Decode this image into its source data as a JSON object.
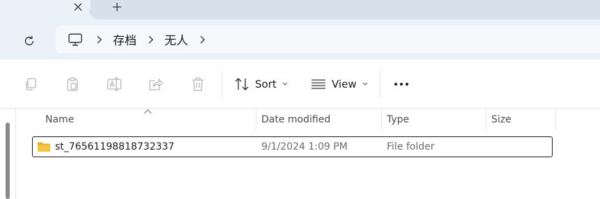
{
  "tabs": {
    "close_icon": "close-icon",
    "new_tab_icon": "plus-icon"
  },
  "address": {
    "refresh_icon": "refresh-icon",
    "pc_icon": "computer-icon",
    "breadcrumb": [
      "存档",
      "无人"
    ]
  },
  "toolbar": {
    "copy_icon": "copy-icon",
    "paste_icon": "paste-icon",
    "rename_icon": "rename-icon",
    "share_icon": "share-icon",
    "delete_icon": "delete-icon",
    "sort_label": "Sort",
    "view_label": "View",
    "more_icon": "more-icon"
  },
  "columns": {
    "name": "Name",
    "date_modified": "Date modified",
    "type": "Type",
    "size": "Size"
  },
  "files": [
    {
      "name": "st_76561198818732337",
      "date_modified": "9/1/2024 1:09 PM",
      "type": "File folder",
      "size": ""
    }
  ],
  "colors": {
    "tabstrip": "#d6e1ec",
    "addressbar": "#ebf1f8",
    "folder": "#f4c542",
    "disabled_icon": "#b5b5b5"
  }
}
